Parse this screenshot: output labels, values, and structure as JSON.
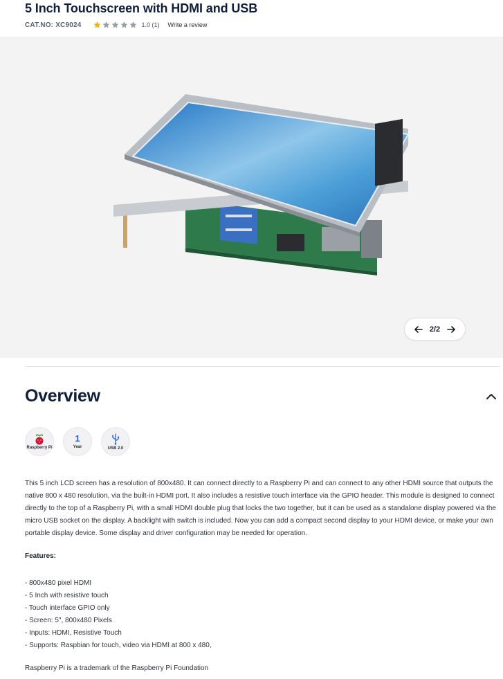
{
  "product": {
    "title": "5 Inch Touchscreen with HDMI and USB",
    "catno": "CAT.NO: XC9024",
    "rating": 1.0,
    "rating_text": "1.0 (1)",
    "write_review": "Write a review"
  },
  "gallery": {
    "pager_text": "2/2",
    "image_icon": "raspberry-pi-touchscreen-photo"
  },
  "overview": {
    "title": "Overview",
    "badges": [
      {
        "icon": "raspberry-pi-icon",
        "label": "Raspberry Pi"
      },
      {
        "value": "1",
        "label": "Year"
      },
      {
        "icon": "usb-icon",
        "label": "USB 2.0"
      }
    ],
    "description": "This 5 inch LCD screen has a resolution of 800x480. It can connect directly to a Raspberry Pi and can connect to any other HDMI source that outputs the native 800 x 480 resolution, via the built-in HDMI port. It also includes a resistive touch interface via the GPIO header. This module is designed to connect directly to the top of a Raspberry Pi, with a small HDMI double plug that locks the two together, but it can be used as a standalone display powered via the micro USB socket on the display. A backlight with switch is included. Now you can add a compact second display to your HDMI device, or make your own portable display device. Some display and driver configuration may be needed for operation.",
    "features_heading": "Features:",
    "features": [
      "- 800x480 pixel HDMI",
      "- 5 Inch with resistive touch",
      "- Touch interface GPIO only",
      "- Screen: 5\", 800x480 Pixels",
      "- Inputs: HDMI, Resistive Touch",
      "- Supports: Raspbian for touch, video via HDMI at 800 x 480,"
    ],
    "trademark": "Raspberry Pi is a trademark of the Raspberry Pi Foundation"
  },
  "colors": {
    "title": "#0f1e3c",
    "star_filled": "#f5b300",
    "star_empty": "#9a9ea6",
    "accent_blue": "#2563eb",
    "gallery_bg": "#f3f3f4"
  }
}
